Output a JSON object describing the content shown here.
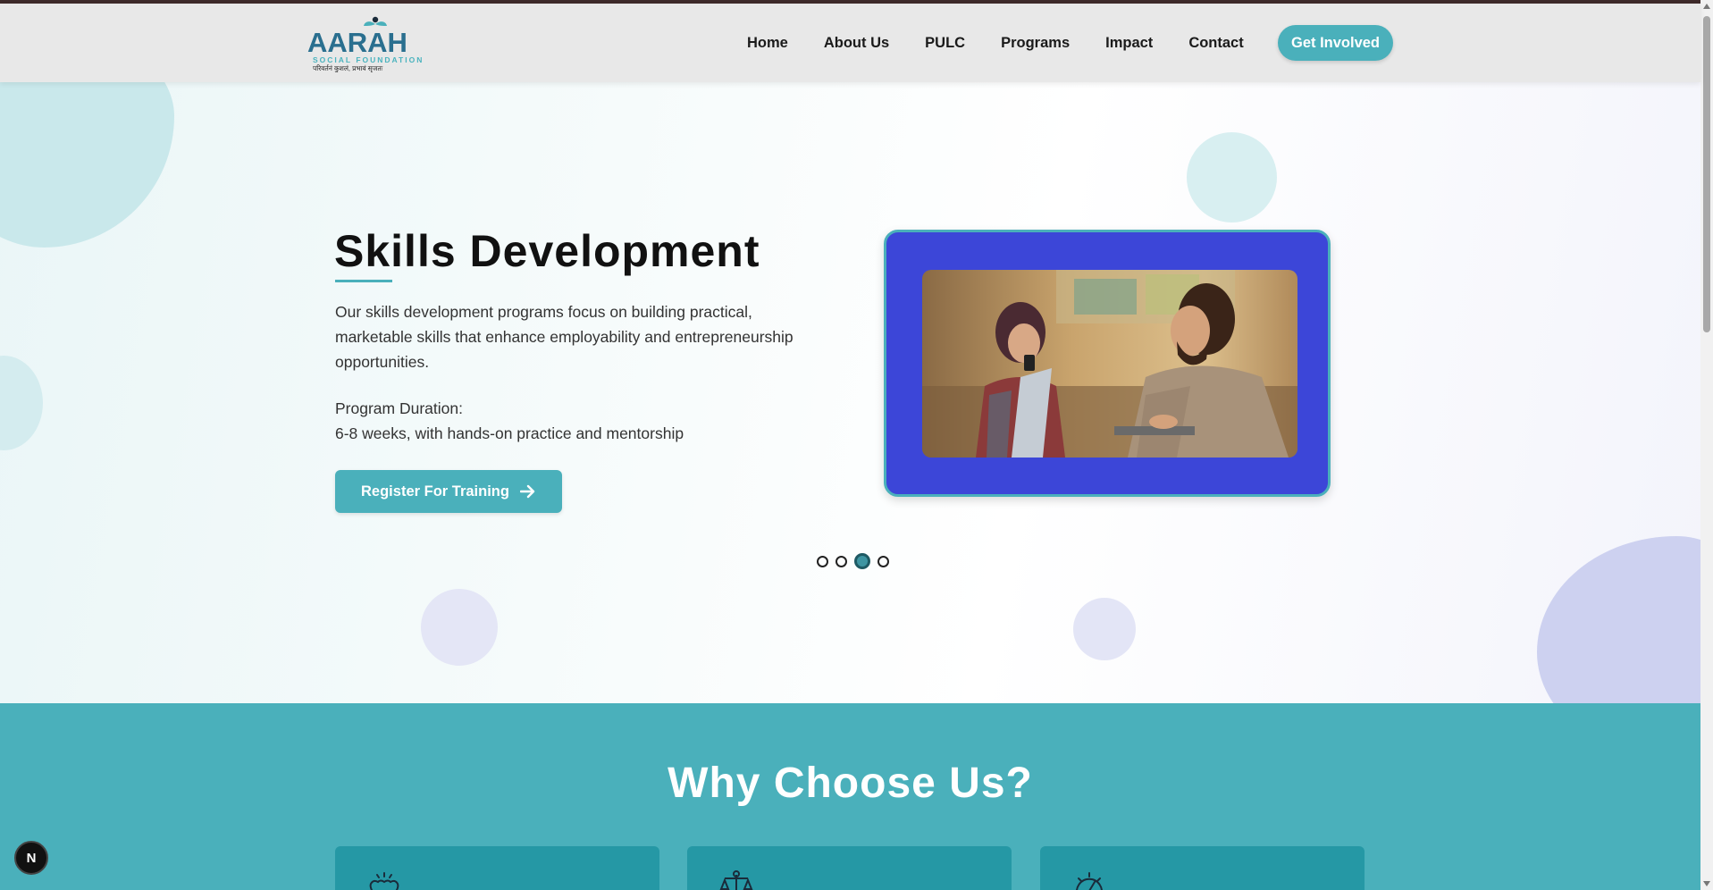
{
  "brand": {
    "logo_main_prefix": "AAR",
    "logo_main_suffix": "AH",
    "logo_sub": "SOCIAL FOUNDATION",
    "logo_tagline": "परिवर्तनं कुशलं, प्रभावं सृजतः",
    "accent_color": "#4ab0bb",
    "frame_color": "#3c46d8"
  },
  "nav": {
    "items": [
      {
        "label": "Home"
      },
      {
        "label": "About Us"
      },
      {
        "label": "PULC"
      },
      {
        "label": "Programs"
      },
      {
        "label": "Impact"
      },
      {
        "label": "Contact"
      }
    ],
    "cta_label": "Get Involved"
  },
  "hero": {
    "title": "Skills Development",
    "description": "Our skills development programs focus on building practical, marketable skills that enhance employability and entrepreneurship opportunities.",
    "duration_label": "Program Duration:",
    "duration_value": "6-8 weeks, with hands-on practice and mentorship",
    "register_label": "Register For Training",
    "register_icon": "arrow-right-icon",
    "slides_total": 4,
    "active_slide": 3
  },
  "why": {
    "title": "Why Choose Us?",
    "card_icons": [
      "heart-hands-icon",
      "balance-scale-icon",
      "speedometer-icon"
    ]
  },
  "dev_badge": {
    "label": "N"
  }
}
